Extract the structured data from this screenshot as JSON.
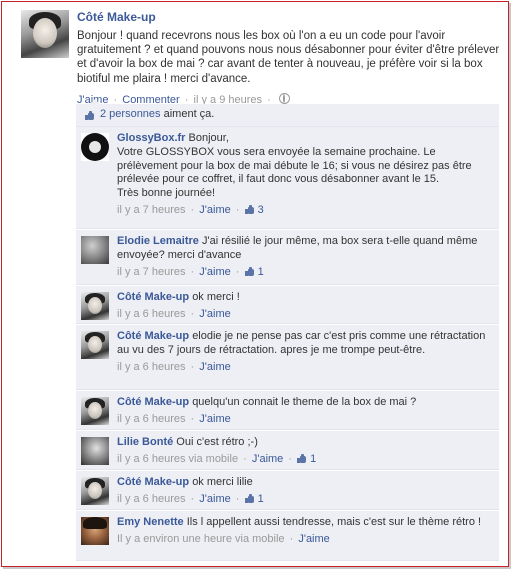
{
  "post": {
    "author": "Côté Make-up",
    "text": "Bonjour ! quand recevrons nous les box où l'on a eu un code pour l'avoir gratuitement ? et quand pouvons nous nous désabonner pour éviter d'être prélever et d'avoir la box de mai ? car avant de tenter à nouveau, je préfère voir si la box biotiful me plaira ! merci d'avance.",
    "like_label": "J'aime",
    "comment_label": "Commenter",
    "time": "il y a 9 heures",
    "separator": "·"
  },
  "likes": {
    "count_link": "2 personnes",
    "suffix": "aiment ça."
  },
  "comments": [
    {
      "author": "GlossyBox.fr",
      "text": "Bonjour,\nVotre GLOSSYBOX vous sera envoyée la semaine prochaine. Le prélèvement pour la box de mai débute le 16; si vous ne désirez pas être prélevée pour ce coffret, il faut donc vous désabonner avant le 15.\nTrès bonne journée!",
      "time": "il y a 7 heures",
      "like_label": "J'aime",
      "like_count": "3"
    },
    {
      "author": "Elodie Lemaitre",
      "text": "J'ai résilié le jour même, ma box sera t-elle quand même envoyée? merci d'avance",
      "time": "il y a 7 heures",
      "like_label": "J'aime",
      "like_count": "1"
    },
    {
      "author": "Côté Make-up",
      "text": "ok merci !",
      "time": "il y a 6 heures",
      "like_label": "J'aime"
    },
    {
      "author": "Côté Make-up",
      "text": "elodie je ne pense pas car c'est pris comme une rétractation au vu des 7 jours de rétractation. apres je me trompe peut-être.",
      "time": "il y a 6 heures",
      "like_label": "J'aime"
    },
    {
      "author": "Côté Make-up",
      "text": "quelqu'un connait le theme de la box de mai ?",
      "time": "il y a 6 heures",
      "like_label": "J'aime"
    },
    {
      "author": "Lilie Bonté",
      "text": "Oui c'est rétro ;-)",
      "time": "il y a 6 heures via mobile",
      "like_label": "J'aime",
      "like_count": "1"
    },
    {
      "author": "Côté Make-up",
      "text": "ok merci lilie",
      "time": "il y a 6 heures",
      "like_label": "J'aime",
      "like_count": "1"
    },
    {
      "author": "Emy Nenette",
      "text": "Ils l appellent aussi tendresse, mais c'est sur le thème rétro !",
      "time": "Il y a environ une heure via mobile",
      "like_label": "J'aime"
    }
  ],
  "colors": {
    "link": "#3b5998",
    "comment_bg": "#edeff4",
    "meta": "#999999",
    "frame": "#c8202a"
  },
  "icons": {
    "like": "thumbs-up-icon",
    "privacy": "globe-icon"
  }
}
